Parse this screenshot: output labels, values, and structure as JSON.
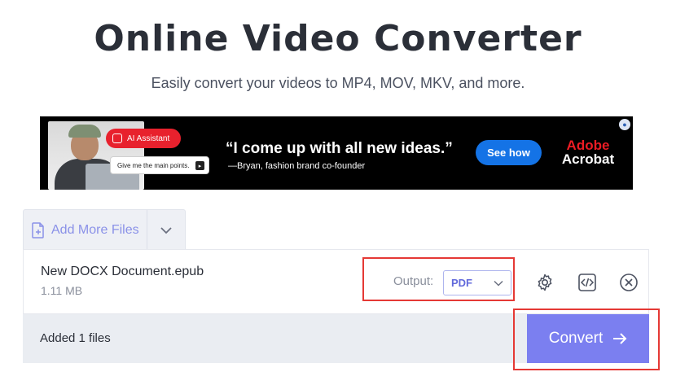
{
  "header": {
    "title": "Online Video Converter",
    "subtitle": "Easily convert your videos to MP4, MOV, MKV, and more."
  },
  "ad": {
    "ai_label": "AI Assistant",
    "prompt_text": "Give me the main points.",
    "quote": "“I come up with all new ideas.”",
    "byline": "—Bryan, fashion brand co-founder",
    "cta_label": "See how",
    "brand_line1": "Adobe",
    "brand_line2": "Acrobat"
  },
  "toolbar": {
    "add_files_label": "Add More Files"
  },
  "file": {
    "name": "New DOCX Document.epub",
    "size": "1.11 MB",
    "output_label": "Output:",
    "output_format": "PDF"
  },
  "footer": {
    "added_count": "Added 1 files",
    "convert_label": "Convert"
  },
  "colors": {
    "accent": "#7b7ff0",
    "highlight": "#e53935",
    "ad_cta": "#1473e6",
    "adobe_red": "#ec1c24"
  },
  "icons": {
    "add_files": "file-plus-icon",
    "dropdown": "chevron-down-icon",
    "select": "chevron-down-icon",
    "settings": "gear-icon",
    "embed": "code-icon",
    "remove": "close-circle-icon",
    "convert": "arrow-right-icon"
  }
}
